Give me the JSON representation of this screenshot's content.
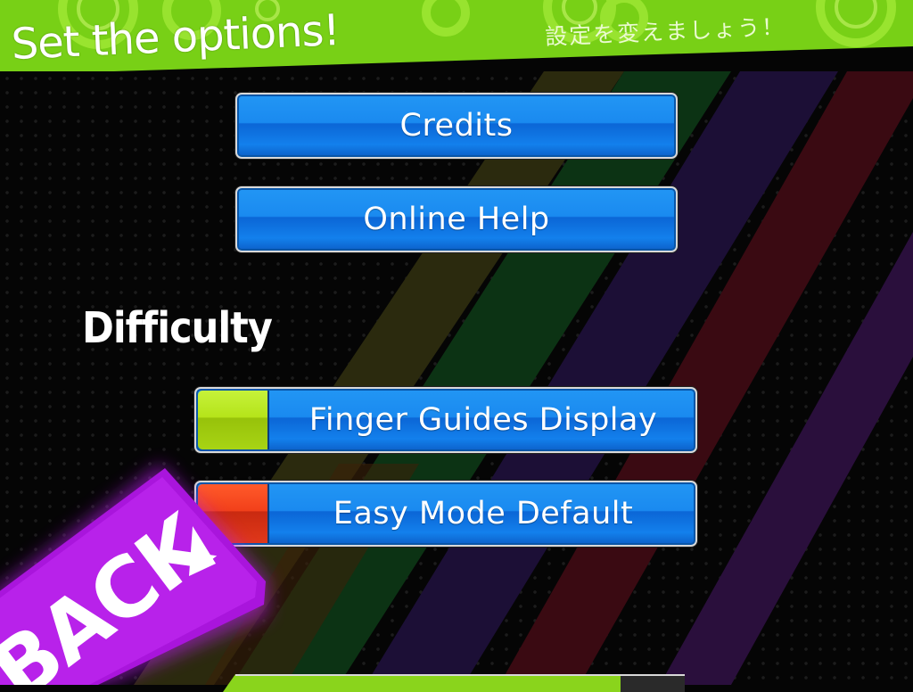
{
  "header": {
    "title": "Set the options!",
    "subtitle_jp": "設定を変えましょう！"
  },
  "buttons": {
    "credits": "Credits",
    "online_help": "Online Help"
  },
  "difficulty": {
    "heading": "Difficulty",
    "finger_guides": {
      "label": "Finger Guides Display",
      "state": "on",
      "color": "#b5e41a"
    },
    "easy_mode": {
      "label": "Easy Mode Default",
      "state": "off",
      "color": "#f2401a"
    }
  },
  "back": {
    "label": "BACK"
  },
  "colors": {
    "header_green": "#7ad41a",
    "button_blue": "#1a8af0",
    "back_purple": "#b21de8",
    "stripe_colors": [
      "#3a3a10",
      "#0d3a12",
      "#2a1448",
      "#420a10"
    ]
  }
}
